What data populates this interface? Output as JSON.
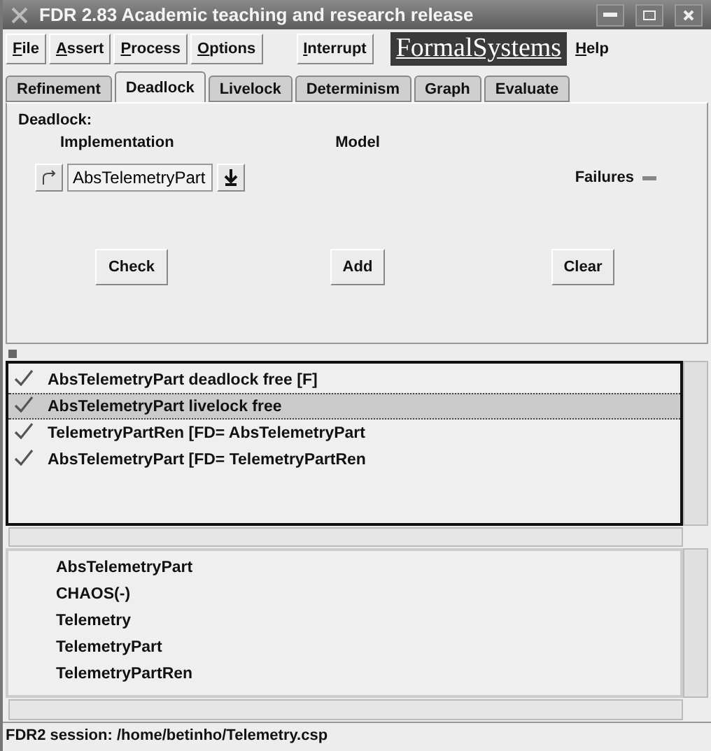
{
  "window": {
    "title": "FDR 2.83 Academic teaching and research release"
  },
  "menu": [
    {
      "label": "File"
    },
    {
      "label": "Assert"
    },
    {
      "label": "Process"
    },
    {
      "label": "Options"
    }
  ],
  "interrupt_button": "Interrupt",
  "logo": "FormalSystems",
  "help_menu": "Help",
  "tabs": [
    {
      "label": "Refinement",
      "selected": false
    },
    {
      "label": "Deadlock",
      "selected": true
    },
    {
      "label": "Livelock",
      "selected": false
    },
    {
      "label": "Determinism",
      "selected": false
    },
    {
      "label": "Graph",
      "selected": false
    },
    {
      "label": "Evaluate",
      "selected": false
    }
  ],
  "panel": {
    "heading": "Deadlock:",
    "implementation_label": "Implementation",
    "implementation_value": "AbsTelemetryPart",
    "model_label": "Model",
    "model_value": "Failures",
    "buttons": [
      "Check",
      "Add",
      "Clear"
    ]
  },
  "results": [
    {
      "text": "AbsTelemetryPart deadlock free [F]",
      "passed": true,
      "selected": false
    },
    {
      "text": "AbsTelemetryPart livelock free",
      "passed": true,
      "selected": true
    },
    {
      "text": "TelemetryPartRen [FD= AbsTelemetryPart",
      "passed": true,
      "selected": false
    },
    {
      "text": "AbsTelemetryPart [FD= TelemetryPartRen",
      "passed": true,
      "selected": false
    }
  ],
  "processes": [
    "AbsTelemetryPart",
    "CHAOS(-)",
    "Telemetry",
    "TelemetryPart",
    "TelemetryPartRen"
  ],
  "status_bar": "FDR2 session: /home/betinho/Telemetry.csp"
}
